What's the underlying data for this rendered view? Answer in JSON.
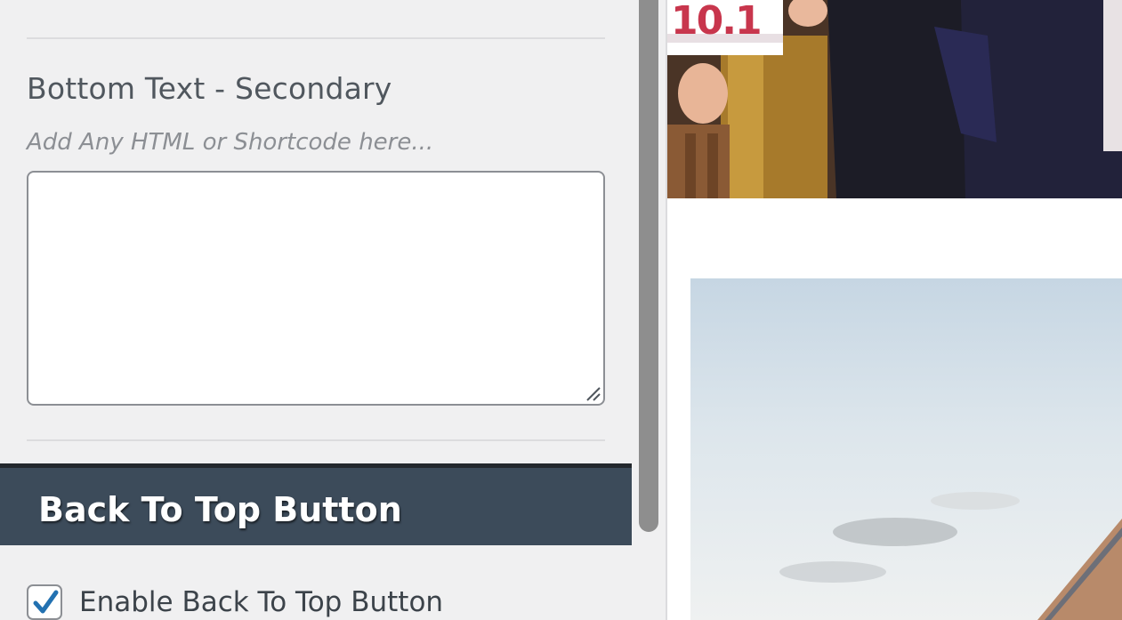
{
  "bottom_text_secondary": {
    "label": "Bottom Text - Secondary",
    "placeholder": "Add Any HTML or Shortcode here...",
    "value": ""
  },
  "back_to_top": {
    "title": "Back To Top Button",
    "enable_label": "Enable Back To Top Button",
    "enabled": true
  },
  "preview": {
    "photo_top_sign_text": "10.1",
    "photo_top_alt": "photo",
    "photo_bottom_alt": "photo"
  },
  "colors": {
    "panel_bg": "#f0f0f1",
    "section_header_bg": "#3c4b5a",
    "checkbox_check": "#2271b1"
  }
}
